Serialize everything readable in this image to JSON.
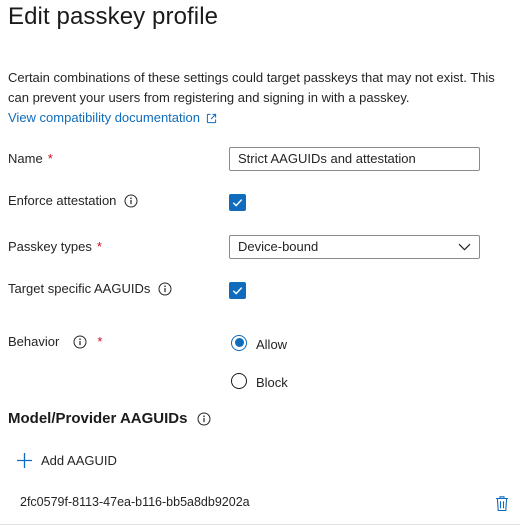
{
  "title": "Edit passkey profile",
  "warning_text": "Certain combinations of these settings could target passkeys that may not exist. This can prevent your users from registering and signing in with a passkey.",
  "compat_link": "View compatibility documentation",
  "fields": {
    "name_label": "Name",
    "name_value": "Strict AAGUIDs and attestation",
    "enforce_label": "Enforce attestation",
    "enforce_checked": true,
    "passkey_types_label": "Passkey types",
    "passkey_types_value": "Device-bound",
    "target_label": "Target specific AAGUIDs",
    "target_checked": true,
    "behavior_label": "Behavior",
    "behavior_options": [
      "Allow",
      "Block"
    ],
    "behavior_selected": "Allow"
  },
  "required_marker": "*",
  "aaguid_section": {
    "title": "Model/Provider AAGUIDs",
    "add_label": "Add AAGUID",
    "items": [
      "2fc0579f-8113-47ea-b116-bb5a8db9202a"
    ]
  },
  "colors": {
    "accent": "#0f6cbd",
    "required": "#c50f1f",
    "text": "#242424"
  }
}
